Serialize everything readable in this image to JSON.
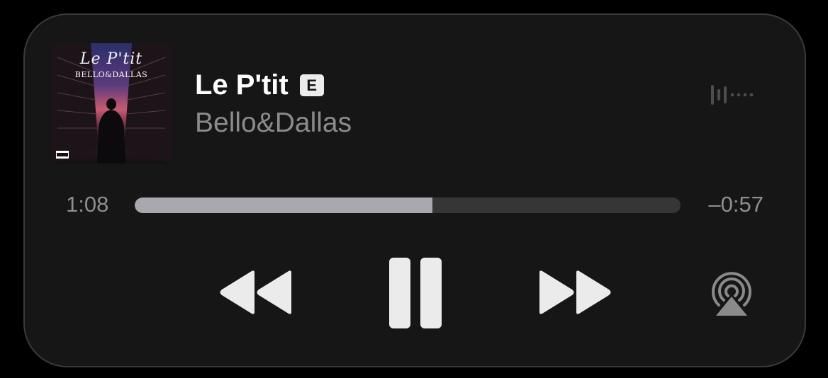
{
  "now_playing": {
    "artwork": {
      "title_text": "Le P'tit",
      "artist_text": "BELLO&DALLAS"
    },
    "title": "Le P'tit",
    "explicit_badge": "E",
    "artist": "Bello&Dallas"
  },
  "progress": {
    "elapsed": "1:08",
    "remaining": "–0:57",
    "fraction": 0.545
  },
  "controls": {
    "rewind_icon": "backward-icon",
    "pause_icon": "pause-icon",
    "forward_icon": "forward-icon",
    "airplay_icon": "airplay-icon",
    "waveform_icon": "waveform-icon"
  },
  "colors": {
    "background": "#161616",
    "primary_text": "#ffffff",
    "secondary_text": "#8b8b8b",
    "progress_fill": "#a8a8ae",
    "progress_track": "#363636",
    "control": "#ebebeb"
  }
}
